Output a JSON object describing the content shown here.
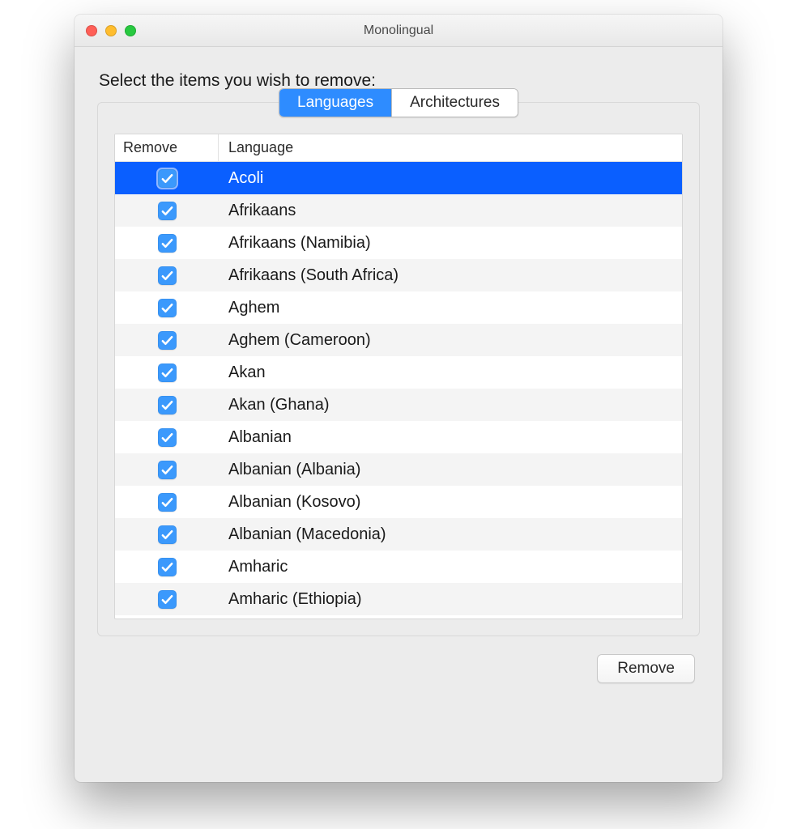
{
  "window": {
    "title": "Monolingual"
  },
  "prompt": "Select the items you wish to remove:",
  "tabs": {
    "languages": "Languages",
    "architectures": "Architectures",
    "active": "languages"
  },
  "columns": {
    "remove": "Remove",
    "language": "Language"
  },
  "rows": [
    {
      "checked": true,
      "selected": true,
      "name": "Acoli"
    },
    {
      "checked": true,
      "selected": false,
      "name": "Afrikaans"
    },
    {
      "checked": true,
      "selected": false,
      "name": "Afrikaans (Namibia)"
    },
    {
      "checked": true,
      "selected": false,
      "name": "Afrikaans (South Africa)"
    },
    {
      "checked": true,
      "selected": false,
      "name": "Aghem"
    },
    {
      "checked": true,
      "selected": false,
      "name": "Aghem (Cameroon)"
    },
    {
      "checked": true,
      "selected": false,
      "name": "Akan"
    },
    {
      "checked": true,
      "selected": false,
      "name": "Akan (Ghana)"
    },
    {
      "checked": true,
      "selected": false,
      "name": "Albanian"
    },
    {
      "checked": true,
      "selected": false,
      "name": "Albanian (Albania)"
    },
    {
      "checked": true,
      "selected": false,
      "name": "Albanian (Kosovo)"
    },
    {
      "checked": true,
      "selected": false,
      "name": "Albanian (Macedonia)"
    },
    {
      "checked": true,
      "selected": false,
      "name": "Amharic"
    },
    {
      "checked": true,
      "selected": false,
      "name": "Amharic (Ethiopia)"
    }
  ],
  "buttons": {
    "remove": "Remove"
  },
  "colors": {
    "accent": "#2e8cff",
    "selection": "#0a5fff",
    "checkbox": "#3b99fc"
  }
}
